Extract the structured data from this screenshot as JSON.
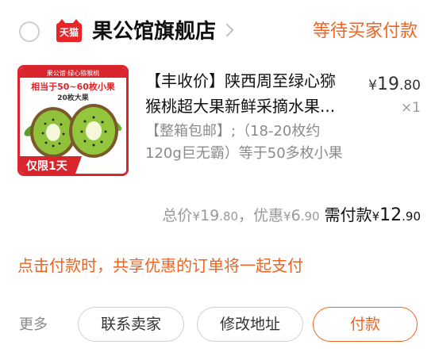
{
  "shop": {
    "badge": "天猫",
    "name": "果公馆旗舰店",
    "status": "等待买家付款"
  },
  "product": {
    "image_banner": "果公馆·绿心猕猴桃",
    "image_headline": "相当于50~60枚小果",
    "image_sub": "20枚大果",
    "image_tag": "仅限1天",
    "title_line1": "【丰收价】陕西周至绿心猕",
    "title_line2": "猴桃超大果新鲜采摘水果...",
    "sku_line1": "【整箱包邮】;（18-20枚约",
    "sku_line2": "120g巨无霸）等于50多枚小果",
    "price_symbol": "¥",
    "price_int": "19",
    "price_dec": ".80",
    "quantity": "×1"
  },
  "totals": {
    "total_label": "总价",
    "total_int": "19",
    "total_dec": ".80",
    "discount_label": "，优惠",
    "discount_int": "6",
    "discount_dec": ".90",
    "need_label": "需付款",
    "need_int": "12",
    "need_dec": ".90",
    "yen": "¥"
  },
  "notice": "点击付款时，共享优惠的订单将一起支付",
  "actions": {
    "more": "更多",
    "contact": "联系卖家",
    "edit_address": "修改地址",
    "pay": "付款"
  },
  "colors": {
    "accent": "#f06320",
    "tmall_red": "#e8262a"
  }
}
